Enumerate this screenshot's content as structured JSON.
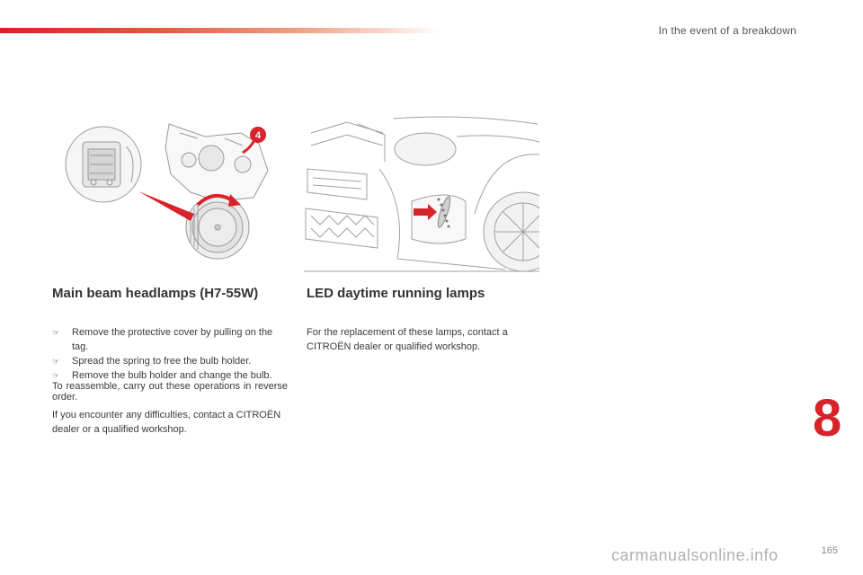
{
  "header": {
    "chapter_title": "In the event of a breakdown"
  },
  "sections": {
    "main_beam": {
      "title": "Main beam headlamps (H7-55W)",
      "steps": [
        "Remove the protective cover by pulling on the tag.",
        "Spread the spring to free the bulb holder.",
        "Remove the bulb holder and change the bulb."
      ],
      "reassemble": "To reassemble, carry out these operations in reverse order.",
      "difficulties": "If you encounter any difficulties, contact a CITROËN dealer or a qualified workshop."
    },
    "led": {
      "title": "LED daytime running lamps",
      "text": "For the replacement of these lamps, contact a CITROËN dealer or qualified workshop."
    }
  },
  "figure": {
    "callout_number": "4"
  },
  "chapter_number": "8",
  "page_number": "165",
  "watermark": "carmanualsonline.info",
  "colors": {
    "accent": "#d8232a"
  }
}
